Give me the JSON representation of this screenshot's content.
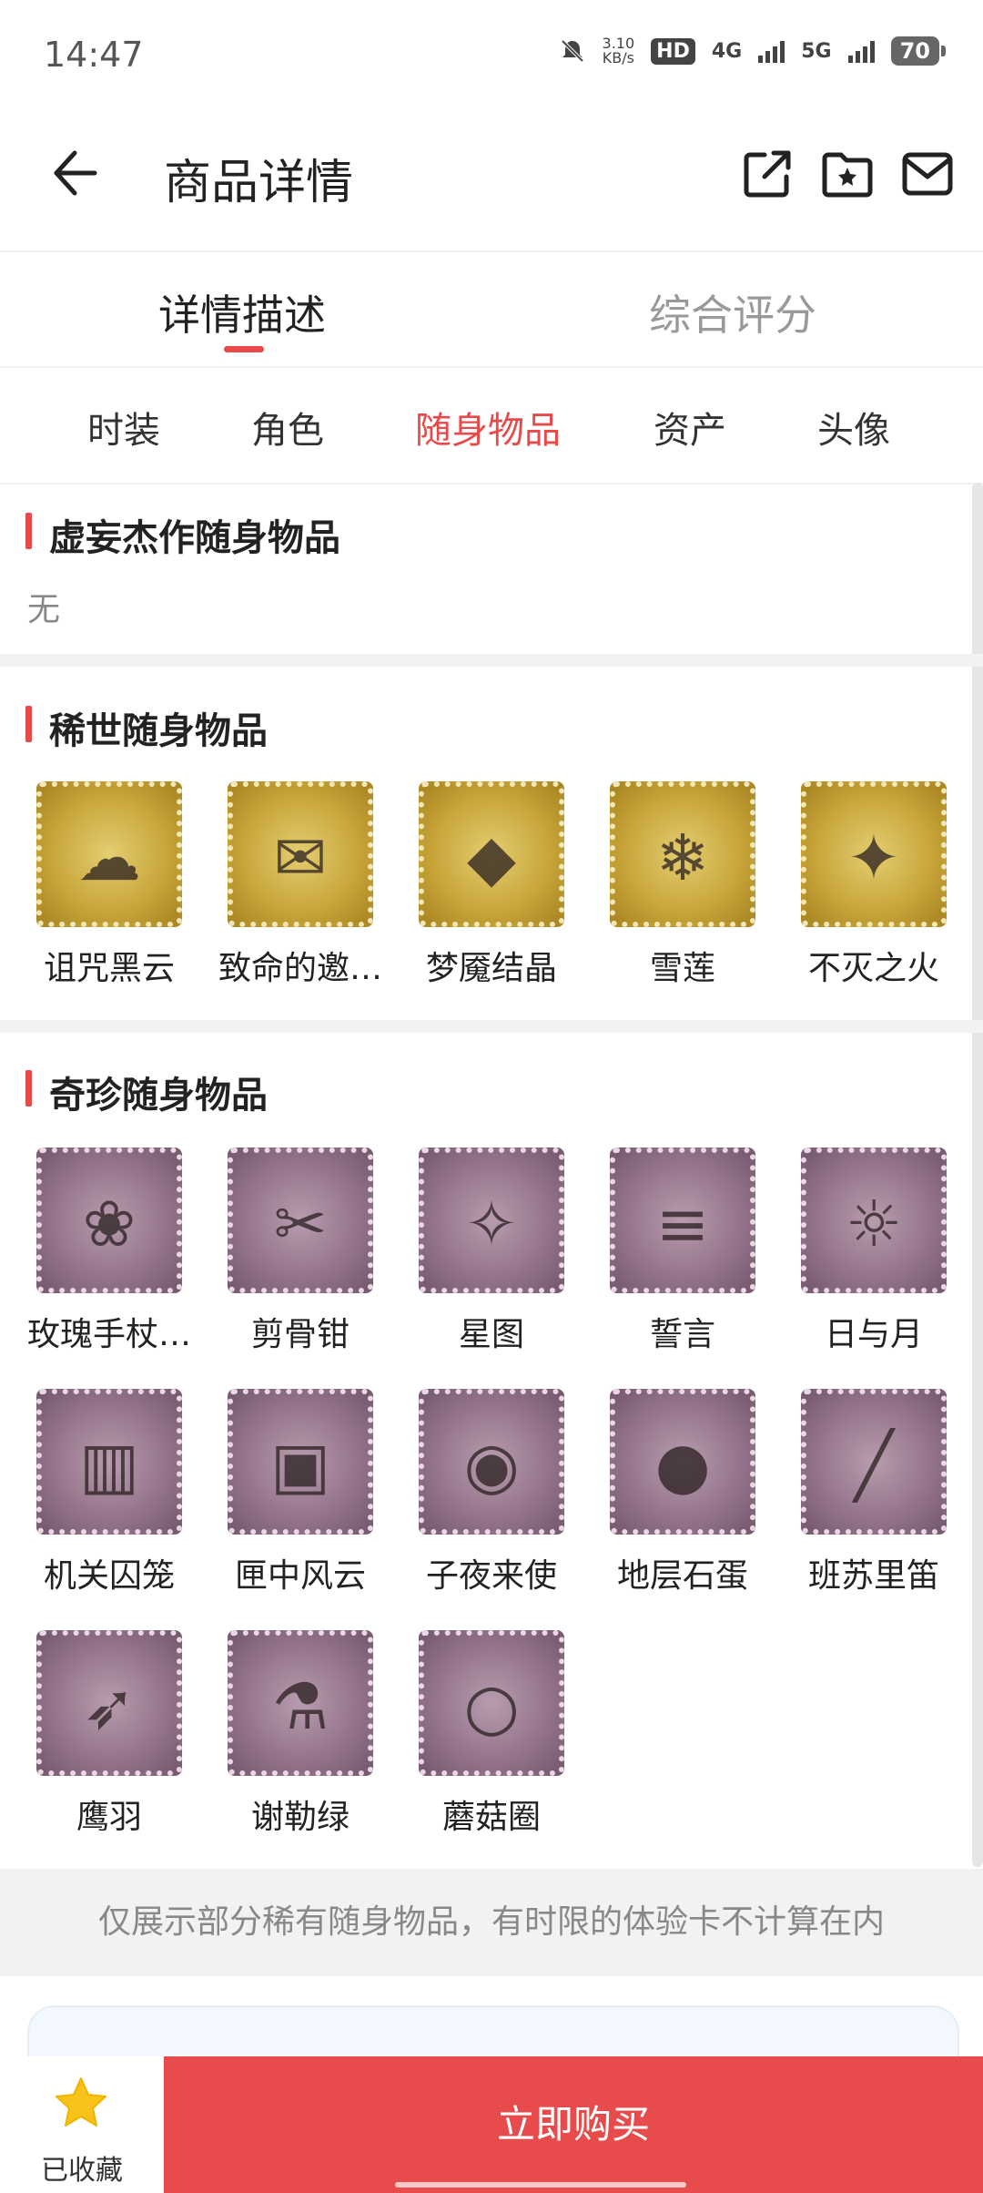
{
  "status_bar": {
    "time": "14:47",
    "speed_value": "3.10",
    "speed_unit": "KB/s",
    "hd": "HD",
    "network_4g": "4G",
    "network_5g": "5G",
    "battery": "70"
  },
  "header": {
    "title": "商品详情",
    "icons": [
      "back-arrow-icon",
      "share-icon",
      "favorite-folder-icon",
      "mail-icon"
    ]
  },
  "tabs": [
    {
      "label": "详情描述",
      "active": true
    },
    {
      "label": "综合评分",
      "active": false
    }
  ],
  "subtabs": [
    {
      "label": "时装",
      "active": false
    },
    {
      "label": "角色",
      "active": false
    },
    {
      "label": "随身物品",
      "active": true
    },
    {
      "label": "资产",
      "active": false
    },
    {
      "label": "头像",
      "active": false
    }
  ],
  "sections": {
    "illusory": {
      "title": "虚妄杰作随身物品",
      "empty_text": "无"
    },
    "rare": {
      "title": "稀世随身物品",
      "items": [
        {
          "label": "诅咒黑云",
          "icon": "black-cloud-orb-icon"
        },
        {
          "label": "致命的邀…",
          "icon": "winged-letter-icon"
        },
        {
          "label": "梦魇结晶",
          "icon": "nightmare-crystal-icon"
        },
        {
          "label": "雪莲",
          "icon": "snow-lotus-icon"
        },
        {
          "label": "不灭之火",
          "icon": "eternal-flame-staff-icon"
        }
      ]
    },
    "precious": {
      "title": "奇珍随身物品",
      "items": [
        {
          "label": "玫瑰手杖…",
          "icon": "rose-cane-icon"
        },
        {
          "label": "剪骨钳",
          "icon": "bone-pliers-icon"
        },
        {
          "label": "星图",
          "icon": "star-map-scroll-icon"
        },
        {
          "label": "誓言",
          "icon": "oath-scroll-icon"
        },
        {
          "label": "日与月",
          "icon": "sun-moon-key-icon"
        },
        {
          "label": "机关囚笼",
          "icon": "mechanism-cage-icon"
        },
        {
          "label": "匣中风云",
          "icon": "storm-box-icon"
        },
        {
          "label": "子夜来使",
          "icon": "midnight-messenger-icon"
        },
        {
          "label": "地层石蛋",
          "icon": "stone-egg-icon"
        },
        {
          "label": "班苏里笛",
          "icon": "bansuri-flute-icon"
        },
        {
          "label": "鹰羽",
          "icon": "eagle-feather-icon"
        },
        {
          "label": "谢勒绿",
          "icon": "scheele-green-icon"
        },
        {
          "label": "蘑菇圈",
          "icon": "mushroom-ring-icon"
        }
      ]
    }
  },
  "notice": "仅展示部分稀有随身物品，有时限的体验卡不计算在内",
  "bottom_bar": {
    "favorite_label": "已收藏",
    "buy_label": "立即购买"
  },
  "colors": {
    "accent": "#e84a4a",
    "favorite_star": "#f7c21a"
  }
}
